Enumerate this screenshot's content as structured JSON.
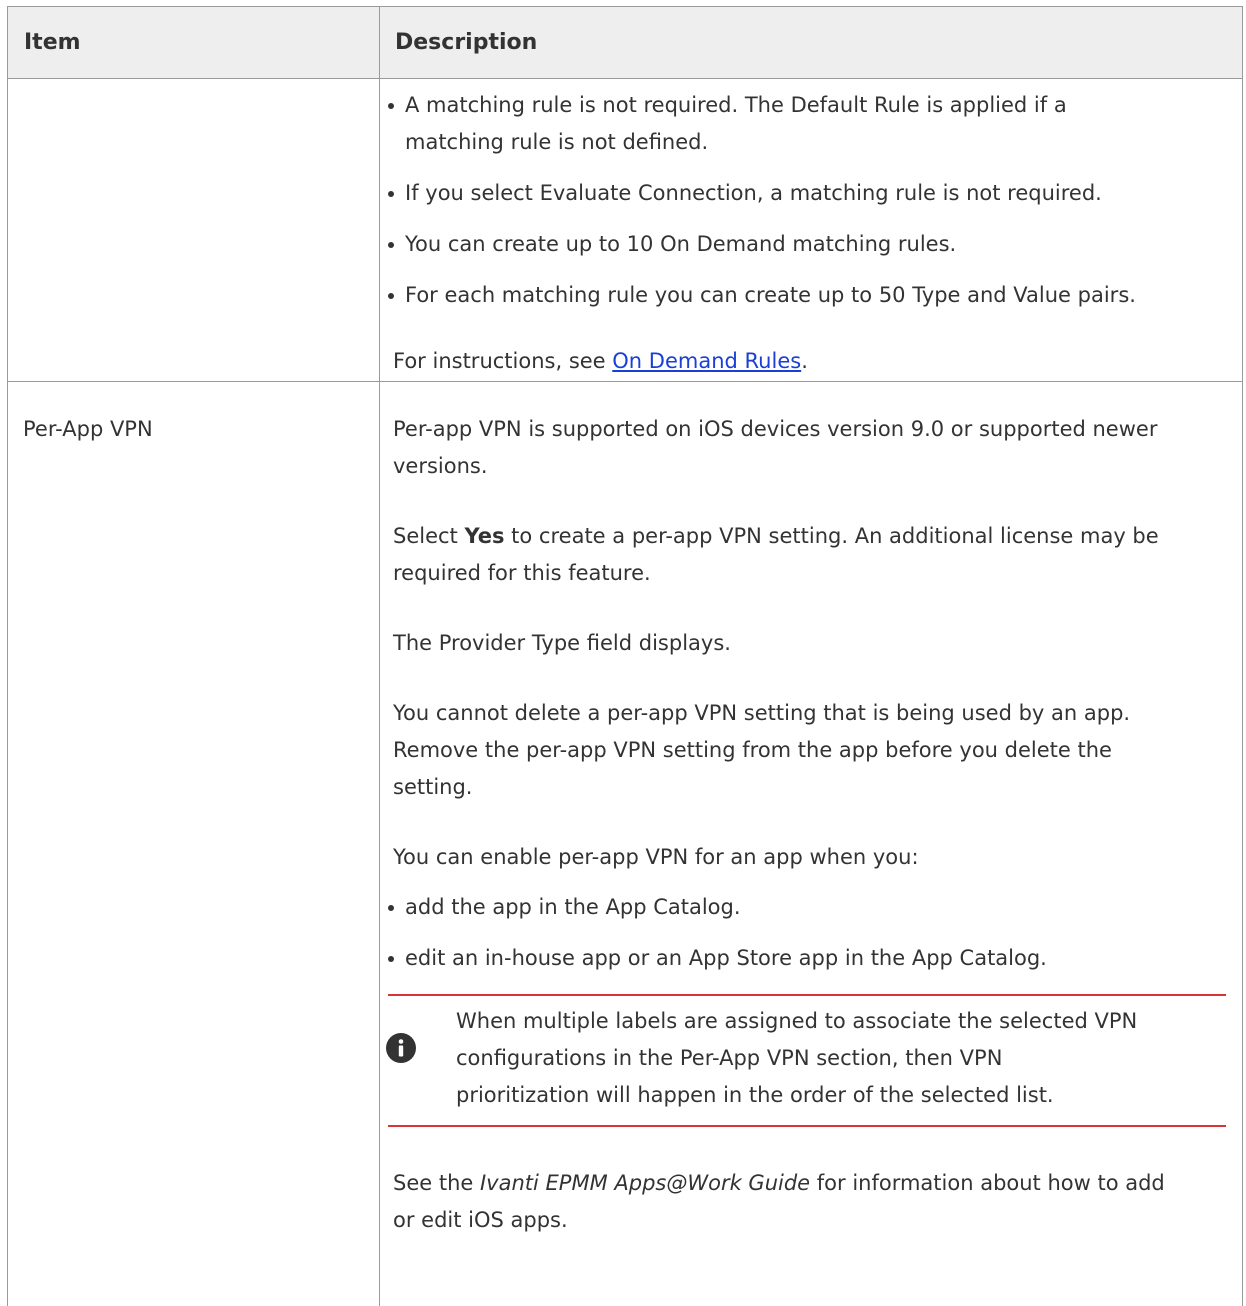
{
  "table": {
    "headers": {
      "item": "Item",
      "description": "Description"
    },
    "row1": {
      "bullets": [
        "A matching rule is not required. The Default Rule is applied if a",
        "matching rule is not defined.",
        "If you select Evaluate Connection, a matching rule is not required.",
        "You can create up to 10 On Demand matching rules.",
        "For each matching rule you can create up to 50 Type and Value pairs."
      ],
      "instructions_prefix": "For instructions, see ",
      "instructions_link": "On Demand Rules",
      "instructions_suffix": "."
    },
    "row2": {
      "item": "Per-App VPN",
      "p1": [
        "Per-app VPN is supported on iOS devices version 9.0 or supported newer",
        "versions."
      ],
      "p2_prefix": "Select ",
      "p2_bold": "Yes",
      "p2_suffix": " to create a per-app VPN setting. An additional license may be",
      "p2_line2": "required for this feature.",
      "p3": "The Provider Type field displays.",
      "p4": [
        "You cannot delete a per-app VPN setting that is being used by an app.",
        "Remove the per-app VPN setting from the app before you delete the",
        "setting."
      ],
      "p5": "You can enable per-app VPN for an app when you:",
      "bullets": [
        "add the app in the App Catalog.",
        "edit an in-house app or an App Store app in the App Catalog."
      ],
      "note": [
        "When multiple labels are assigned to associate the selected VPN",
        "configurations in the Per-App VPN section, then VPN",
        "prioritization will happen in the order of the selected list."
      ],
      "p6_prefix": "See the ",
      "p6_italic": "Ivanti EPMM Apps@Work Guide",
      "p6_suffix": " for information about how to add",
      "p6_line2": "or edit iOS apps."
    }
  },
  "icons": {
    "note": "info-icon"
  },
  "colors": {
    "header_bg": "#eeeeee",
    "note_rule": "#d9343a",
    "link": "#1a3fd6"
  }
}
